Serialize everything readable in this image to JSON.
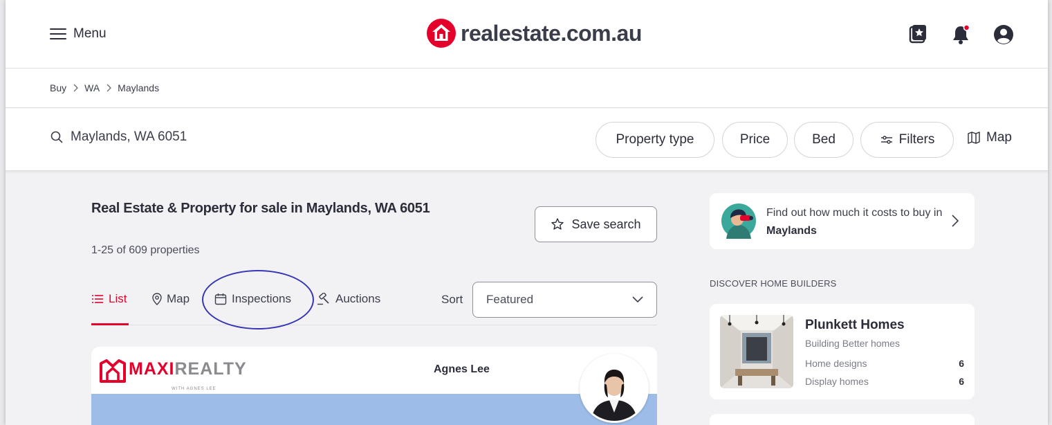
{
  "header": {
    "menu_label": "Menu",
    "logo_text": "realestate.com.au",
    "brand_color": "#e4002b"
  },
  "breadcrumb": {
    "items": [
      "Buy",
      "WA",
      "Maylands"
    ]
  },
  "search": {
    "query": "Maylands, WA 6051",
    "filters": [
      "Property type",
      "Price",
      "Bed",
      "Filters"
    ],
    "map_label": "Map"
  },
  "results": {
    "title": "Real Estate & Property for sale in Maylands, WA 6051",
    "count": "1-25 of 609 properties",
    "save_label": "Save search",
    "tabs": [
      "List",
      "Map",
      "Inspections",
      "Auctions"
    ],
    "active_tab": "List",
    "sort_label": "Sort",
    "sort_value": "Featured"
  },
  "listing": {
    "agency_maxi": "MAXI",
    "agency_realty": "REALTY",
    "agency_sub": "WITH AGNES LEE",
    "agent_name": "Agnes Lee"
  },
  "sidebar": {
    "cost_text": "Find out how much it costs to buy in ",
    "cost_suburb": "Maylands",
    "discover_heading": "DISCOVER HOME BUILDERS",
    "builder": {
      "name": "Plunkett Homes",
      "tagline": "Building Better homes",
      "rows": [
        {
          "label": "Home designs",
          "value": "6"
        },
        {
          "label": "Display homes",
          "value": "6"
        }
      ]
    }
  },
  "annotation_color": "#3636b5"
}
